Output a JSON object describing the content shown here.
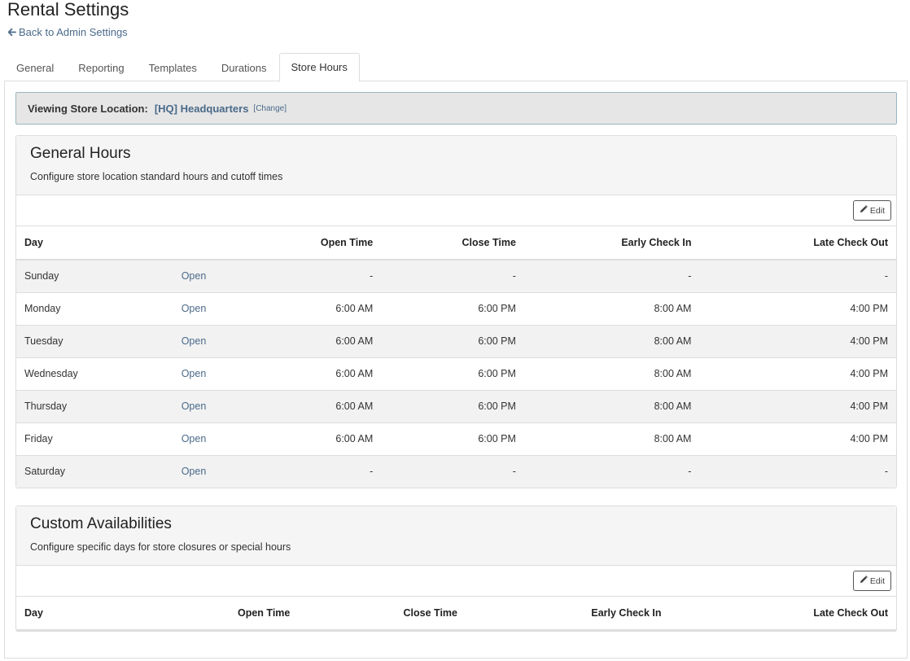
{
  "page": {
    "title": "Rental Settings",
    "back_label": "Back to Admin Settings"
  },
  "tabs": [
    {
      "label": "General",
      "active": false
    },
    {
      "label": "Reporting",
      "active": false
    },
    {
      "label": "Templates",
      "active": false
    },
    {
      "label": "Durations",
      "active": false
    },
    {
      "label": "Store Hours",
      "active": true
    }
  ],
  "location": {
    "label": "Viewing Store Location:",
    "name": "[HQ] Headquarters",
    "change_label": "[Change]"
  },
  "general_hours": {
    "title": "General Hours",
    "description": "Configure store location standard hours and cutoff times",
    "edit_label": "Edit",
    "columns": [
      "Day",
      "Open Time",
      "Close Time",
      "Early Check In",
      "Late Check Out"
    ],
    "rows": [
      {
        "day": "Sunday",
        "status": "Open",
        "open": "-",
        "close": "-",
        "early": "-",
        "late": "-"
      },
      {
        "day": "Monday",
        "status": "Open",
        "open": "6:00 AM",
        "close": "6:00 PM",
        "early": "8:00 AM",
        "late": "4:00 PM"
      },
      {
        "day": "Tuesday",
        "status": "Open",
        "open": "6:00 AM",
        "close": "6:00 PM",
        "early": "8:00 AM",
        "late": "4:00 PM"
      },
      {
        "day": "Wednesday",
        "status": "Open",
        "open": "6:00 AM",
        "close": "6:00 PM",
        "early": "8:00 AM",
        "late": "4:00 PM"
      },
      {
        "day": "Thursday",
        "status": "Open",
        "open": "6:00 AM",
        "close": "6:00 PM",
        "early": "8:00 AM",
        "late": "4:00 PM"
      },
      {
        "day": "Friday",
        "status": "Open",
        "open": "6:00 AM",
        "close": "6:00 PM",
        "early": "8:00 AM",
        "late": "4:00 PM"
      },
      {
        "day": "Saturday",
        "status": "Open",
        "open": "-",
        "close": "-",
        "early": "-",
        "late": "-"
      }
    ]
  },
  "custom_availabilities": {
    "title": "Custom Availabilities",
    "description": "Configure specific days for store closures or special hours",
    "edit_label": "Edit",
    "columns": [
      "Day",
      "Open Time",
      "Close Time",
      "Early Check In",
      "Late Check Out"
    ]
  },
  "icons": {
    "back": "arrow-left-icon",
    "edit": "pencil-icon"
  },
  "colors": {
    "link": "#4a6a8a",
    "location_bar_bg": "#e6e6e6",
    "location_bar_border": "#9bb6c2",
    "stripe": "#f2f2f2"
  }
}
